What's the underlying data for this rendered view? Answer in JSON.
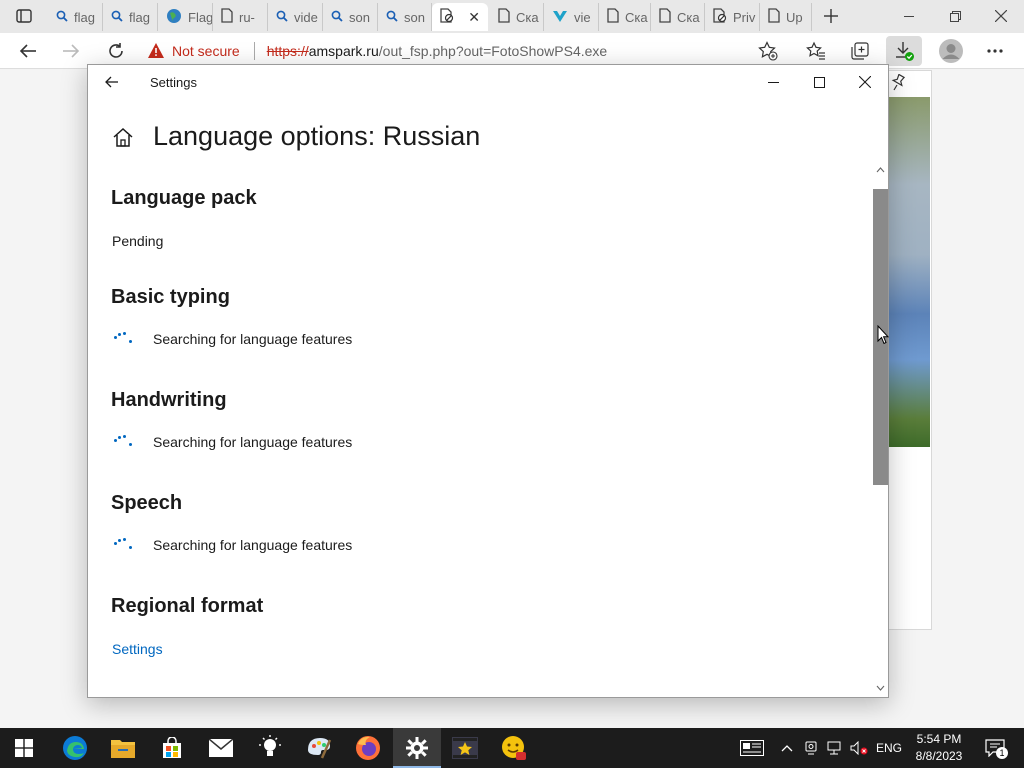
{
  "browser": {
    "tabs": [
      {
        "title": "flag",
        "icon": "search-icon"
      },
      {
        "title": "flag",
        "icon": "search-icon"
      },
      {
        "title": "Flag",
        "icon": "globe-icon"
      },
      {
        "title": "ru-",
        "icon": "page-icon"
      },
      {
        "title": "vide",
        "icon": "search-icon"
      },
      {
        "title": "son",
        "icon": "search-icon"
      },
      {
        "title": "son",
        "icon": "search-icon"
      },
      {
        "title": "",
        "icon": "page-blocked-icon",
        "active": true
      },
      {
        "title": "Ска",
        "icon": "page-icon"
      },
      {
        "title": "vie",
        "icon": "heart-download-icon"
      },
      {
        "title": "Ска",
        "icon": "page-icon"
      },
      {
        "title": "Ска",
        "icon": "page-icon"
      },
      {
        "title": "Priv",
        "icon": "page-blocked-icon"
      },
      {
        "title": "Up",
        "icon": "page-icon"
      }
    ],
    "not_secure_label": "Not secure",
    "url": {
      "scheme": "https://",
      "host": "amspark.ru",
      "path": "/out_fsp.php?out=FotoShowPS4.exe"
    }
  },
  "settings": {
    "window_title": "Settings",
    "page_title": "Language options: Russian",
    "sections": {
      "language_pack": {
        "heading": "Language pack",
        "status": "Pending"
      },
      "basic_typing": {
        "heading": "Basic typing",
        "status": "Searching for language features"
      },
      "handwriting": {
        "heading": "Handwriting",
        "status": "Searching for language features"
      },
      "speech": {
        "heading": "Speech",
        "status": "Searching for language features"
      },
      "regional_format": {
        "heading": "Regional format",
        "link": "Settings"
      }
    }
  },
  "taskbar": {
    "apps": [
      "windows-start",
      "edge",
      "file-explorer",
      "microsoft-store",
      "mail",
      "tips",
      "paint",
      "firefox",
      "settings",
      "video-editor",
      "emoji-app"
    ],
    "language": "ENG",
    "time": "5:54 PM",
    "date": "8/8/2023",
    "notification_count": "1"
  },
  "colors": {
    "accent": "#0067c0",
    "warning": "#c42b1c"
  }
}
